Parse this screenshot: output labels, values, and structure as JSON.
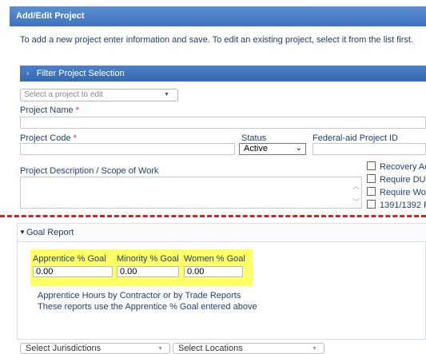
{
  "header": {
    "title": "Add/Edit Project"
  },
  "intro_text": "To add a new project enter information and save. To edit an existing project, select it from the list first.",
  "filter_bar": {
    "label": "Filter Project Selection"
  },
  "project_select": {
    "placeholder": "Select a project to edit"
  },
  "fields": {
    "project_name": {
      "label": "Project Name",
      "required_mark": "*"
    },
    "project_code": {
      "label": "Project Code",
      "required_mark": "*"
    },
    "status": {
      "label": "Status",
      "value": "Active"
    },
    "federal_aid_id": {
      "label": "Federal-aid Project ID"
    },
    "description": {
      "label": "Project Description / Scope of Work"
    }
  },
  "checkboxes": [
    {
      "label": "Recovery Ac"
    },
    {
      "label": "Require DUI"
    },
    {
      "label": "Require Wor"
    },
    {
      "label": "1391/1392 F"
    }
  ],
  "goal_report": {
    "title": "Goal Report",
    "apprentice": {
      "label": "Apprentice % Goal",
      "value": "0.00"
    },
    "minority": {
      "label": "Minority % Goal",
      "value": "0.00"
    },
    "women": {
      "label": "Women % Goal",
      "value": "0.00"
    },
    "note_line1": "Apprentice Hours by Contractor or by Trade Reports",
    "note_line2": "These reports use the Apprentice % Goal entered above"
  },
  "bottom_selects": {
    "jurisdictions": "Select Jurisdictions",
    "locations": "Select Locations"
  },
  "colors": {
    "header_blue": "#3d72bf",
    "highlight_yellow": "#ffff66",
    "dashed_red": "#d2231f",
    "text_blue": "#1f3f7a"
  }
}
